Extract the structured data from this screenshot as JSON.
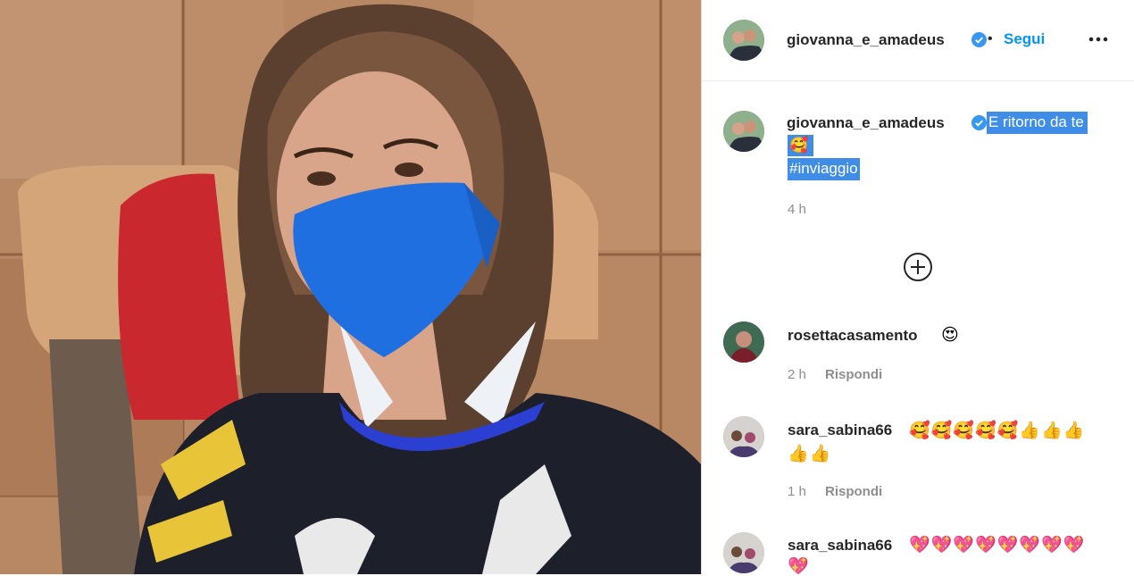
{
  "post": {
    "author": "giovanna_e_amadeus",
    "separator": "•",
    "follow_label": "Segui",
    "more_icon": "more-horizontal-icon",
    "caption": {
      "author": "giovanna_e_amadeus",
      "text": "E ritorno da te",
      "emoji": "🥰",
      "hashtag": "#inviaggio",
      "time": "4 h"
    },
    "load_more_icon": "plus-circle-icon"
  },
  "comments": [
    {
      "user": "rosettacasamento",
      "text": "😍",
      "time": "2 h",
      "reply": "Rispondi"
    },
    {
      "user": "sara_sabina66",
      "text": "🥰🥰🥰🥰🥰👍👍👍",
      "text2": "👍👍",
      "time": "1 h",
      "reply": "Rispondi"
    },
    {
      "user": "sara_sabina66",
      "text": "💖💖💖💖💖💖💖💖",
      "text2": "💖"
    }
  ],
  "colors": {
    "follow": "#0095f6",
    "verified": "#3897f0",
    "selection": "#3f8de7"
  }
}
